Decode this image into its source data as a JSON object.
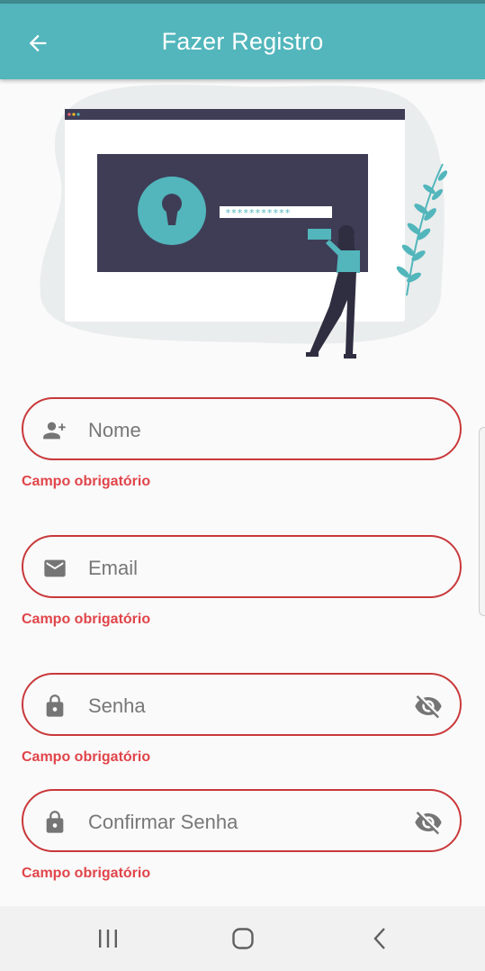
{
  "header": {
    "title": "Fazer Registro",
    "back_icon": "arrow-back-icon",
    "color": "#52b6bc"
  },
  "form": {
    "name": {
      "placeholder": "Nome",
      "value": "",
      "icon": "person-add-icon",
      "error": "Campo obrigatório"
    },
    "email": {
      "placeholder": "Email",
      "value": "",
      "icon": "email-icon",
      "error": "Campo obrigatório"
    },
    "password": {
      "placeholder": "Senha",
      "value": "",
      "icon": "lock-icon",
      "toggle_icon": "visibility-off-icon",
      "error": "Campo obrigatório"
    },
    "confirm_password": {
      "placeholder": "Confirmar Senha",
      "value": "",
      "icon": "lock-icon",
      "toggle_icon": "visibility-off-icon",
      "error": "Campo obrigatório"
    }
  },
  "illustration": {
    "password_mask": "***********"
  },
  "colors": {
    "error": "#e0454a",
    "border": "#c9383a",
    "icon": "#757575"
  },
  "navbar": {
    "recents_icon": "recents-icon",
    "home_icon": "home-icon",
    "back_icon": "nav-back-icon"
  }
}
